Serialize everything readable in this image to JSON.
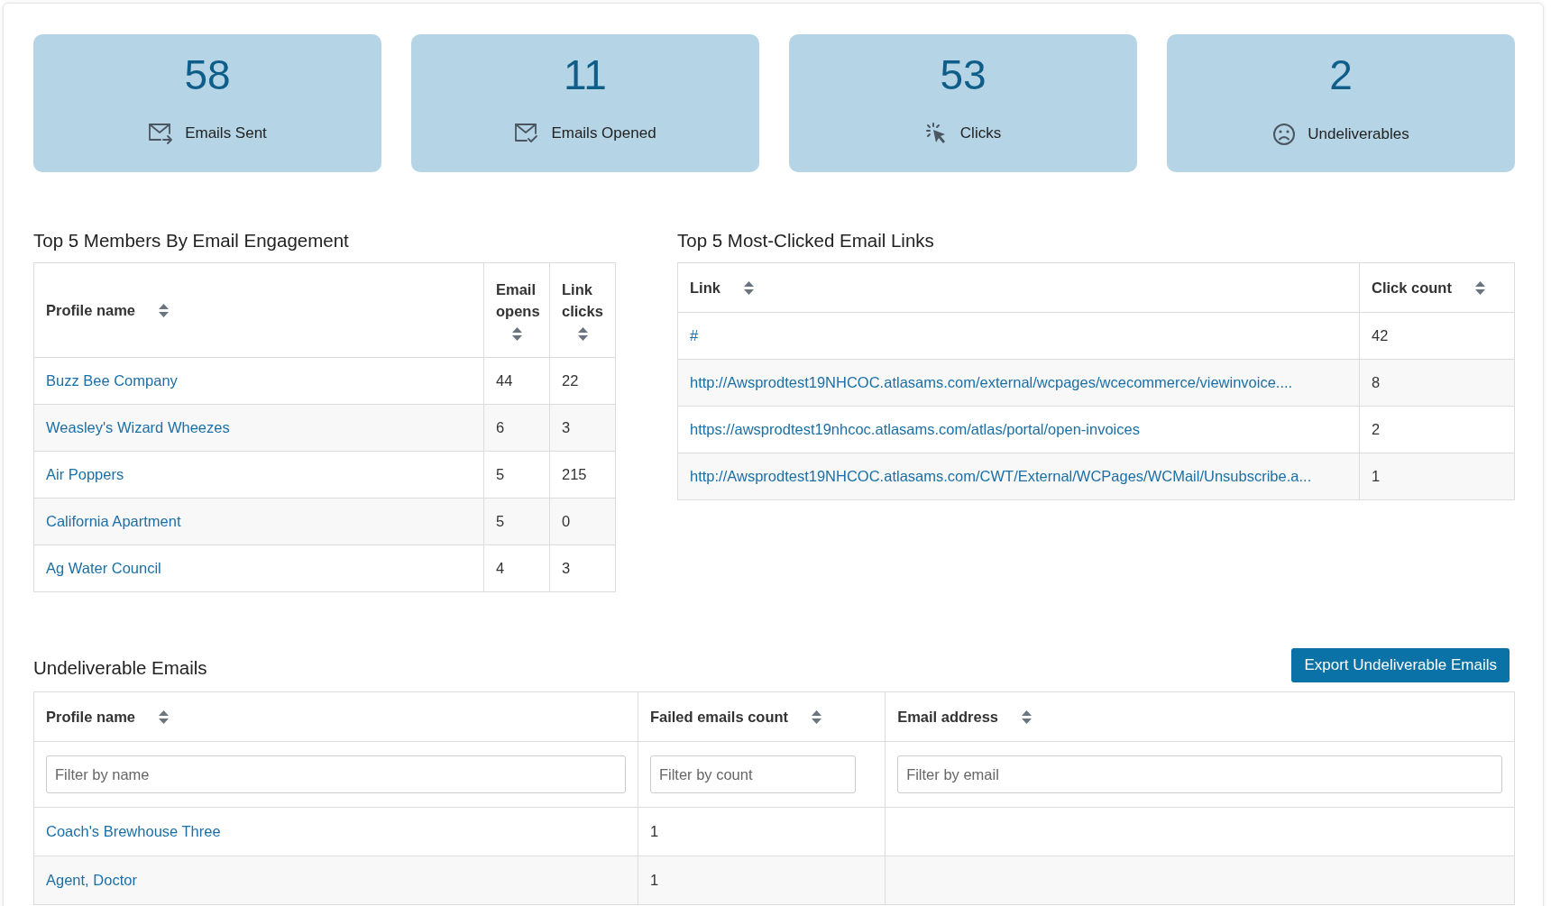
{
  "stats": [
    {
      "value": "58",
      "label": "Emails Sent",
      "kind": "sent"
    },
    {
      "value": "11",
      "label": "Emails Opened",
      "kind": "opened"
    },
    {
      "value": "53",
      "label": "Clicks",
      "kind": "clicks"
    },
    {
      "value": "2",
      "label": "Undeliverables",
      "kind": "undeliverable"
    }
  ],
  "members_table": {
    "title": "Top 5 Members By Email Engagement",
    "columns": [
      {
        "label": "Profile name"
      },
      {
        "label": "Email opens"
      },
      {
        "label": "Link clicks"
      }
    ],
    "rows": [
      [
        "Buzz Bee Company",
        "44",
        "22"
      ],
      [
        "Weasley's Wizard Wheezes",
        "6",
        "3"
      ],
      [
        "Air Poppers",
        "5",
        "215"
      ],
      [
        "California Apartment",
        "5",
        "0"
      ],
      [
        "Ag Water Council",
        "4",
        "3"
      ]
    ]
  },
  "links_table": {
    "title": "Top 5 Most-Clicked Email Links",
    "columns": [
      {
        "label": "Link"
      },
      {
        "label": "Click count"
      }
    ],
    "rows": [
      [
        "#",
        "42"
      ],
      [
        "http://Awsprodtest19NHCOC.atlasams.com/external/wcpages/wcecommerce/viewinvoice....",
        "8"
      ],
      [
        "https://awsprodtest19nhcoc.atlasams.com/atlas/portal/open-invoices",
        "2"
      ],
      [
        "http://Awsprodtest19NHCOC.atlasams.com/CWT/External/WCPages/WCMail/Unsubscribe.a...",
        "1"
      ]
    ]
  },
  "undeliverable_table": {
    "title": "Undeliverable Emails",
    "export_button": "Export Undeliverable Emails",
    "columns": [
      {
        "label": "Profile name",
        "placeholder": "Filter by name"
      },
      {
        "label": "Failed emails count",
        "placeholder": "Filter by count"
      },
      {
        "label": "Email address",
        "placeholder": "Filter by email"
      }
    ],
    "rows": [
      [
        "Coach's Brewhouse Three",
        "1",
        ""
      ],
      [
        "Agent, Doctor",
        "1",
        ""
      ]
    ]
  }
}
